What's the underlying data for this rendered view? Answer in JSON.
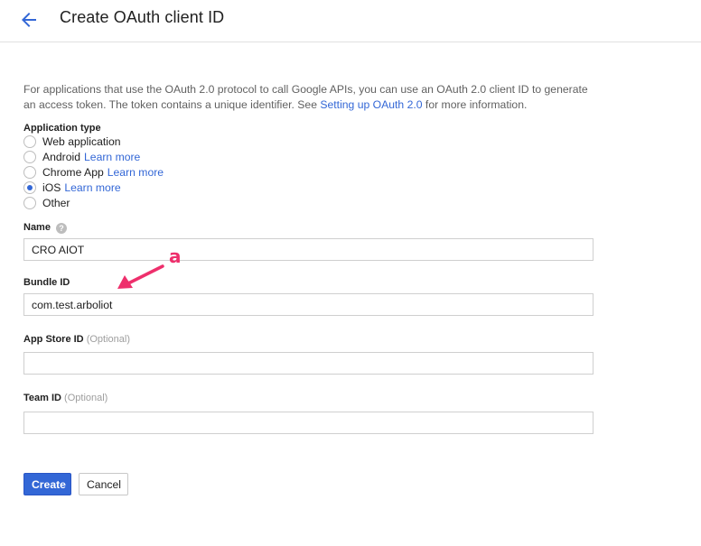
{
  "header": {
    "title": "Create OAuth client ID",
    "back_icon": "arrow-left-icon"
  },
  "intro": {
    "text_before_link": "For applications that use the OAuth 2.0 protocol to call Google APIs, you can use an OAuth 2.0 client ID to generate an access token. The token contains a unique identifier. See ",
    "link_text": "Setting up OAuth 2.0",
    "text_after_link": " for more information."
  },
  "application_type": {
    "label": "Application type",
    "options": [
      {
        "label": "Web application",
        "link": "",
        "checked": false
      },
      {
        "label": "Android",
        "link": "Learn more",
        "checked": false
      },
      {
        "label": "Chrome App",
        "link": "Learn more",
        "checked": false
      },
      {
        "label": "iOS",
        "link": "Learn more",
        "checked": true
      },
      {
        "label": "Other",
        "link": "",
        "checked": false
      }
    ]
  },
  "fields": {
    "name": {
      "label": "Name",
      "value": "CRO AIOT",
      "help_icon": "question-circle-icon"
    },
    "bundle_id": {
      "label": "Bundle ID",
      "value": "com.test.arboliot"
    },
    "app_store_id": {
      "label": "App Store ID",
      "optional": "(Optional)",
      "value": ""
    },
    "team_id": {
      "label": "Team ID",
      "optional": "(Optional)",
      "value": ""
    }
  },
  "buttons": {
    "create": "Create",
    "cancel": "Cancel"
  },
  "annotation": {
    "label": "a",
    "color": "#ee2f6c"
  },
  "colors": {
    "accent": "#3367d6",
    "annotation": "#ee2f6c"
  }
}
